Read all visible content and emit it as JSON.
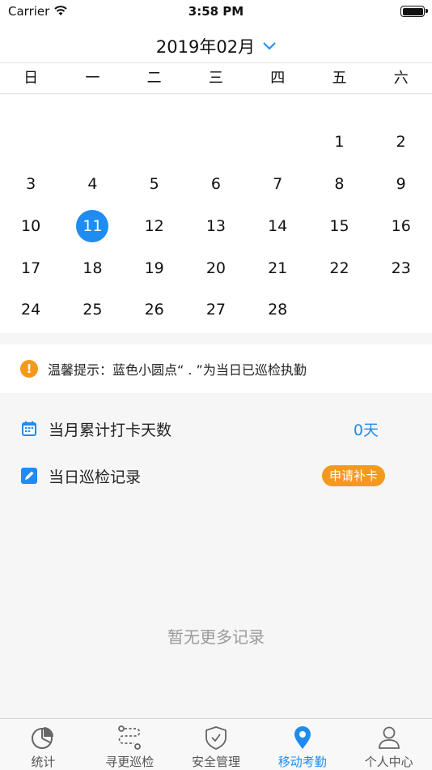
{
  "status_bar": {
    "carrier": "Carrier",
    "time": "3:58 PM"
  },
  "header": {
    "month": "2019年02月"
  },
  "weekdays": [
    "日",
    "一",
    "二",
    "三",
    "四",
    "五",
    "六"
  ],
  "calendar": {
    "weeks": [
      [
        "",
        "",
        "",
        "",
        "",
        "1",
        "2"
      ],
      [
        "3",
        "4",
        "5",
        "6",
        "7",
        "8",
        "9"
      ],
      [
        "10",
        "11",
        "12",
        "13",
        "14",
        "15",
        "16"
      ],
      [
        "17",
        "18",
        "19",
        "20",
        "21",
        "22",
        "23"
      ],
      [
        "24",
        "25",
        "26",
        "27",
        "28",
        "",
        ""
      ]
    ],
    "selected_day": "11"
  },
  "tip": {
    "icon": "info-icon",
    "text": "温馨提示：蓝色小圆点“ . ”为当日已巡检执勤"
  },
  "monthly": {
    "label": "当月累计打卡天数",
    "value": "0天",
    "icon": "calendar-icon"
  },
  "daily": {
    "label": "当日巡检记录",
    "button": "申请补卡",
    "icon": "edit-icon"
  },
  "empty_text": "暂无更多记录",
  "tabs": [
    {
      "label": "统计",
      "icon": "pie-chart-icon"
    },
    {
      "label": "寻更巡检",
      "icon": "route-icon"
    },
    {
      "label": "安全管理",
      "icon": "shield-icon"
    },
    {
      "label": "移动考勤",
      "icon": "location-pin-icon"
    },
    {
      "label": "个人中心",
      "icon": "person-icon"
    }
  ],
  "active_tab": "移动考勤",
  "colors": {
    "accent": "#1e8cf0",
    "warning": "#f39a1e"
  }
}
